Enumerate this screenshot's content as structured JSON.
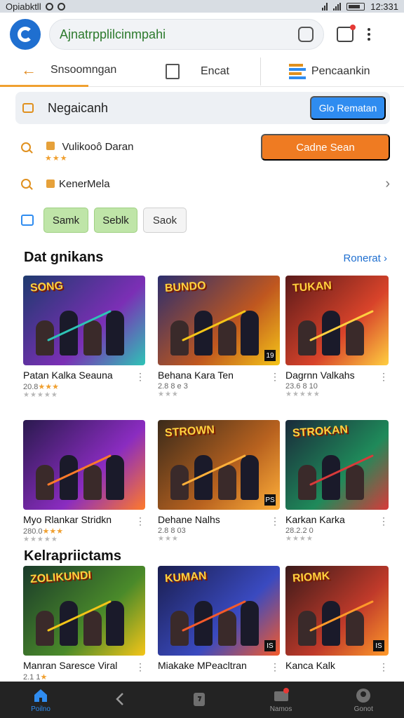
{
  "status_bar": {
    "left_text": "Opiabktll",
    "time": "12:331"
  },
  "browser": {
    "url": "Ajnatrpplilcinmpahi"
  },
  "tabs": [
    {
      "label": "Snsoomngan"
    },
    {
      "label": "Encat"
    },
    {
      "label": "Pencaankin"
    }
  ],
  "promo": {
    "label": "Negaicanh",
    "button": "Glo Rematan"
  },
  "rows": [
    {
      "label": "Vulikooô Daran",
      "stars": "★★★",
      "button": "Cadne Sean"
    },
    {
      "label": "KenerMela"
    }
  ],
  "chips": [
    "Samk",
    "Seblk",
    "Saok"
  ],
  "section1": {
    "title": "Dat gnikans",
    "see_all": "Ronerat"
  },
  "section2": {
    "title": "Kelrapriictams"
  },
  "colors": {
    "accent_blue": "#2f8cf0",
    "accent_orange": "#ef7b22",
    "chip_green": "#bfe5a8"
  },
  "games": [
    {
      "title": "Patan Kalka Seauna",
      "meta": "20.8",
      "stars": "★★★",
      "rating": "★★★★★",
      "thumb_text": "SONG",
      "corner": ""
    },
    {
      "title": "Behana Kara Ten",
      "meta": "2.8 8 e 3",
      "stars": "",
      "rating": "★★★",
      "thumb_text": "BUNDO",
      "corner": "19"
    },
    {
      "title": "Dagrnn Valkahs",
      "meta": "23.6 8 10",
      "stars": "",
      "rating": "★★★★★",
      "thumb_text": "TUKAN",
      "corner": ""
    },
    {
      "title": "Myo Rlankar Stridkn",
      "meta": "280.0",
      "stars": "★★★",
      "rating": "★★★★★",
      "thumb_text": "",
      "corner": ""
    },
    {
      "title": "Dehane Nalhs",
      "meta": "2.8 8 03",
      "stars": "",
      "rating": "★★★",
      "thumb_text": "STROWN",
      "corner": "PS"
    },
    {
      "title": "Karkan Karka",
      "meta": "28.2.2 0",
      "stars": "",
      "rating": "★★★★",
      "thumb_text": "STROKAN",
      "corner": ""
    },
    {
      "title": "Manran Saresce Viral",
      "meta": "2.1 1",
      "stars": "★",
      "rating": "",
      "thumb_text": "ZOLIKUNDI",
      "corner": ""
    },
    {
      "title": "Miakake MPeacltran",
      "meta": "",
      "stars": "",
      "rating": "",
      "thumb_text": "KUMAN",
      "corner": "IS"
    },
    {
      "title": "Kanca Kalk",
      "meta": "",
      "stars": "",
      "rating": "",
      "thumb_text": "RIOMK",
      "corner": "IS"
    }
  ],
  "bottom_nav": [
    {
      "label": "Poilno",
      "icon": "home-icon"
    },
    {
      "label": "",
      "icon": "back-icon"
    },
    {
      "label": "",
      "icon": "tabs-icon"
    },
    {
      "label": "Namos",
      "icon": "notifications-icon"
    },
    {
      "label": "Gonot",
      "icon": "profile-icon"
    }
  ]
}
